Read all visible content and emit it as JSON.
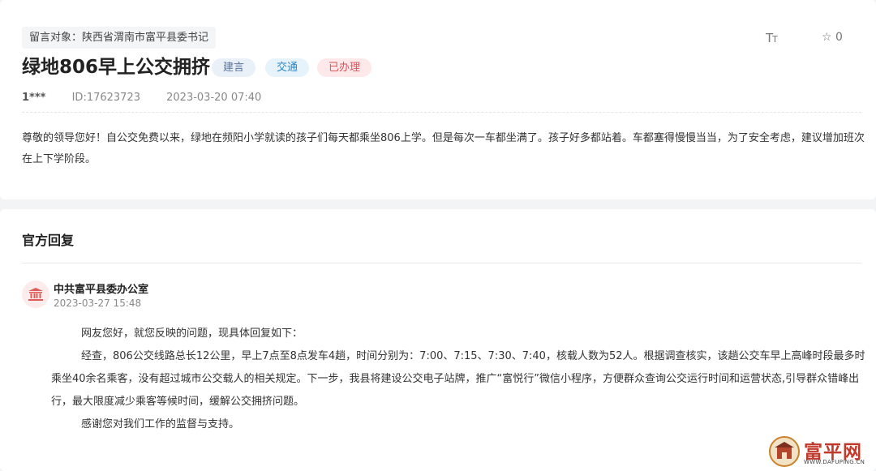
{
  "message": {
    "target_label": "留言对象：陕西省渭南市富平县委书记",
    "title": "绿地806早上公交拥挤",
    "tags": [
      "建言",
      "交通",
      "已办理"
    ],
    "user": "1***",
    "id_text": "ID:17623723",
    "datetime": "2023-03-20 07:40",
    "content": "尊敬的领导您好！自公交免费以来，绿地在频阳小学就读的孩子们每天都乘坐806上学。但是每次一车都坐满了。孩子好多都站着。车都塞得慢慢当当，为了安全考虑，建议增加班次在上下学阶段。"
  },
  "toolbar": {
    "font_size_icon": "Tт",
    "star_count": "0"
  },
  "reply": {
    "section_title": "官方回复",
    "org_name": "中共富平县委办公室",
    "date": "2023-03-27 15:48",
    "paragraphs": [
      "网友您好，就您反映的问题，现具体回复如下：",
      "经查，806公交线路总长12公里，早上7点至8点发车4趟，时间分别为：7:00、7:15、7:30、7:40，核载人数为52人。根据调查核实，该趟公交车早上高峰时段最多时乘坐40余名乘客，没有超过城市公交载人的相关规定。下一步，我县将建设公交电子站牌，推广“富悦行”微信小程序，方便群众查询公交运行时间和运营状态,引导群众错峰出行，最大限度减少乘客等候时间，缓解公交拥挤问题。",
      "感谢您对我们工作的监督与支持。"
    ]
  },
  "watermark": {
    "text": "富平网",
    "url": "WWW.DAFUPING.CN"
  },
  "colors": {
    "tag_suggestion": "#5a7396",
    "tag_traffic": "#2f86c4",
    "tag_done": "#d9535b",
    "avatar_icon": "#e05a5a"
  }
}
